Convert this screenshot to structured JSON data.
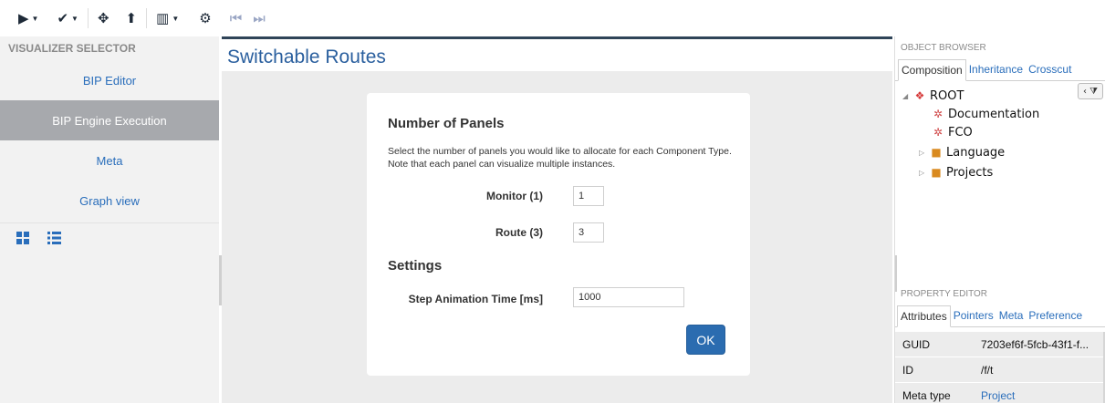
{
  "toolbar": {
    "items": [
      {
        "name": "play",
        "glyph": "▶"
      },
      {
        "name": "check",
        "glyph": "✔"
      },
      {
        "name": "move",
        "glyph": "✥"
      },
      {
        "name": "upload",
        "glyph": "⬆"
      },
      {
        "name": "layout",
        "glyph": "▥"
      },
      {
        "name": "cogs",
        "glyph": "⚙"
      },
      {
        "name": "step-back",
        "glyph": "⏮"
      },
      {
        "name": "step-forward",
        "glyph": "⏭"
      }
    ]
  },
  "visualizer": {
    "title": "VISUALIZER SELECTOR",
    "items": [
      {
        "label": "BIP Editor"
      },
      {
        "label": "BIP Engine Execution"
      },
      {
        "label": "Meta"
      },
      {
        "label": "Graph view"
      }
    ],
    "active_index": 1
  },
  "main": {
    "title": "Switchable Routes",
    "dialog": {
      "heading": "Number of Panels",
      "description": "Select the number of panels you would like to allocate for each Component Type. Note that each panel can visualize multiple instances.",
      "fields": [
        {
          "label": "Monitor (1)",
          "value": "1"
        },
        {
          "label": "Route (3)",
          "value": "3"
        }
      ],
      "settings_heading": "Settings",
      "step_label": "Step Animation Time [ms]",
      "step_value": "1000",
      "ok_label": "OK"
    }
  },
  "object_browser": {
    "title": "OBJECT BROWSER",
    "tabs": [
      "Composition",
      "Inheritance",
      "Crosscut"
    ],
    "collapse_glyph": "‹ ⧩",
    "tree": [
      {
        "label": "ROOT",
        "toggle": "◢",
        "icon": "❖",
        "icon_color": "#d63b3b"
      },
      {
        "label": "Documentation",
        "toggle": "",
        "icon": "✲",
        "icon_color": "#d04a4a"
      },
      {
        "label": "FCO",
        "toggle": "",
        "icon": "✲",
        "icon_color": "#d04a4a"
      },
      {
        "label": "Language",
        "toggle": "▷",
        "icon": "■",
        "icon_color": "#d98a1f"
      },
      {
        "label": "Projects",
        "toggle": "▷",
        "icon": "■",
        "icon_color": "#d98a1f"
      }
    ]
  },
  "property_editor": {
    "title": "PROPERTY EDITOR",
    "tabs": [
      "Attributes",
      "Pointers",
      "Meta",
      "Preference"
    ],
    "rows": [
      {
        "key": "GUID",
        "value": "7203ef6f-5fcb-43f1-f..."
      },
      {
        "key": "ID",
        "value": "/f/t"
      },
      {
        "key": "Meta type",
        "value": "Project"
      }
    ]
  }
}
